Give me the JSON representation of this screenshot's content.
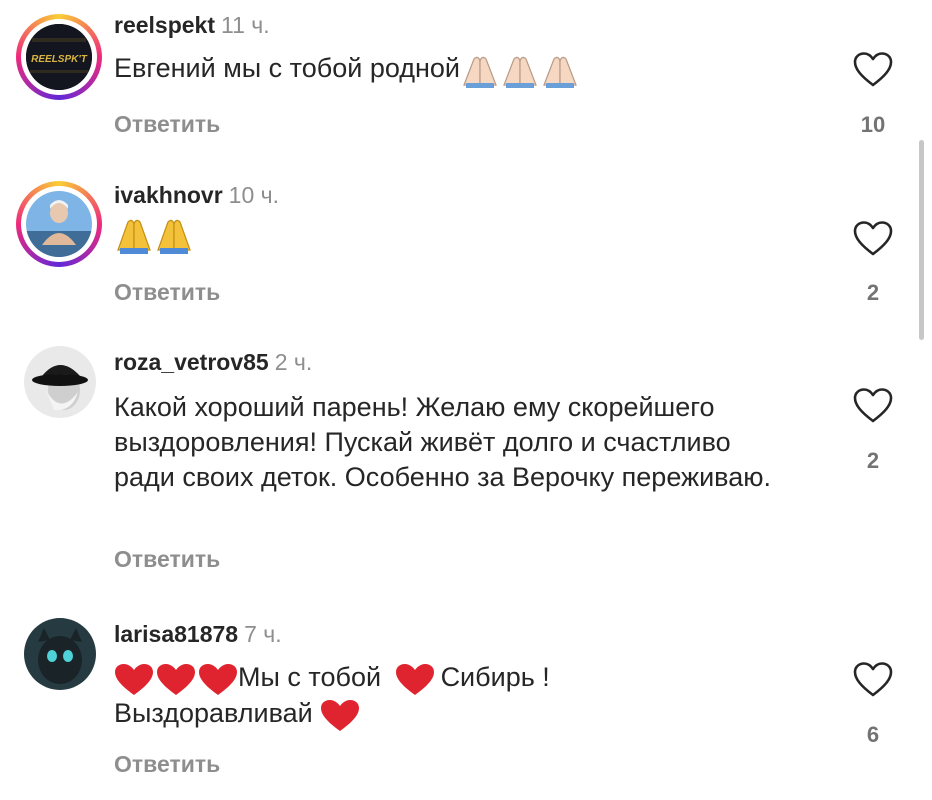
{
  "comments": [
    {
      "username": "reelspekt",
      "time": "11 ч.",
      "text": "Евгений мы с тобой родной",
      "text_emoji": "🙏🏻🙏🏻🙏🏻",
      "reply_label": "Ответить",
      "likes": "10",
      "avatar_text": "REELSPK'T"
    },
    {
      "username": "ivakhnovr",
      "time": "10 ч.",
      "text_emoji": "🙏🙏",
      "reply_label": "Ответить",
      "likes": "2"
    },
    {
      "username": "roza_vetrov85",
      "time": "2 ч.",
      "text": "Какой хороший парень! Желаю ему скорейшего выздоровления! Пускай живёт долго и счастливо ради своих деток. Особенно за Верочку переживаю.",
      "reply_label": "Ответить",
      "likes": "2"
    },
    {
      "username": "larisa81878",
      "time": "7 ч.",
      "text_part1_emoji": "❤️❤️❤️",
      "text_part1": "Мы с тобой",
      "text_part2_emoji": "❤️",
      "text_part2": "Сибирь !",
      "text_part3": "Выздоравливай",
      "text_part3_emoji": "❤️",
      "reply_label": "Ответить",
      "likes": "6"
    }
  ],
  "icons": {
    "like": "heart-outline-icon",
    "pray": "folded-hands-emoji",
    "heart": "red-heart-emoji"
  },
  "colors": {
    "username": "#262626",
    "secondary": "#8e8e8e",
    "story_ring_start": "#f9ce34",
    "story_ring_mid": "#ee2a7b",
    "heart_red": "#e0242f"
  }
}
